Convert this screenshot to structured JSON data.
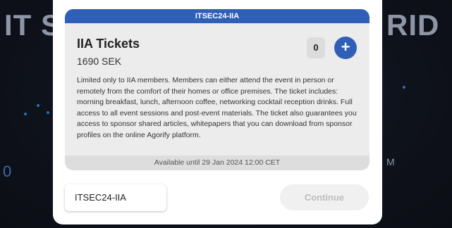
{
  "background": {
    "title_left": "IT S",
    "title_right": "RID",
    "fragment_m": "M",
    "fragment_zero": "0"
  },
  "ticket": {
    "header": "ITSEC24-IIA",
    "title": "IIA Tickets",
    "price": "1690 SEK",
    "quantity": "0",
    "add_symbol": "+",
    "description": "Limited only to IIA members. Members can either attend the event in person or remotely from the comfort of their homes or office premises. The ticket includes: morning breakfast, lunch, afternoon coffee, networking cocktail reception drinks. Full access to all event sessions and post-event materials. The ticket also guarantees you access to sponsor shared articles, whitepapers that you can download from sponsor profiles on the online Agorify platform.",
    "availability": "Available until 29 Jan 2024 12:00 CET"
  },
  "footer": {
    "code": "ITSEC24-IIA",
    "continue_label": "Continue"
  },
  "colors": {
    "accent": "#2f5fb6",
    "card_bg": "#ececec",
    "disabled_text": "#bdbdbd"
  }
}
